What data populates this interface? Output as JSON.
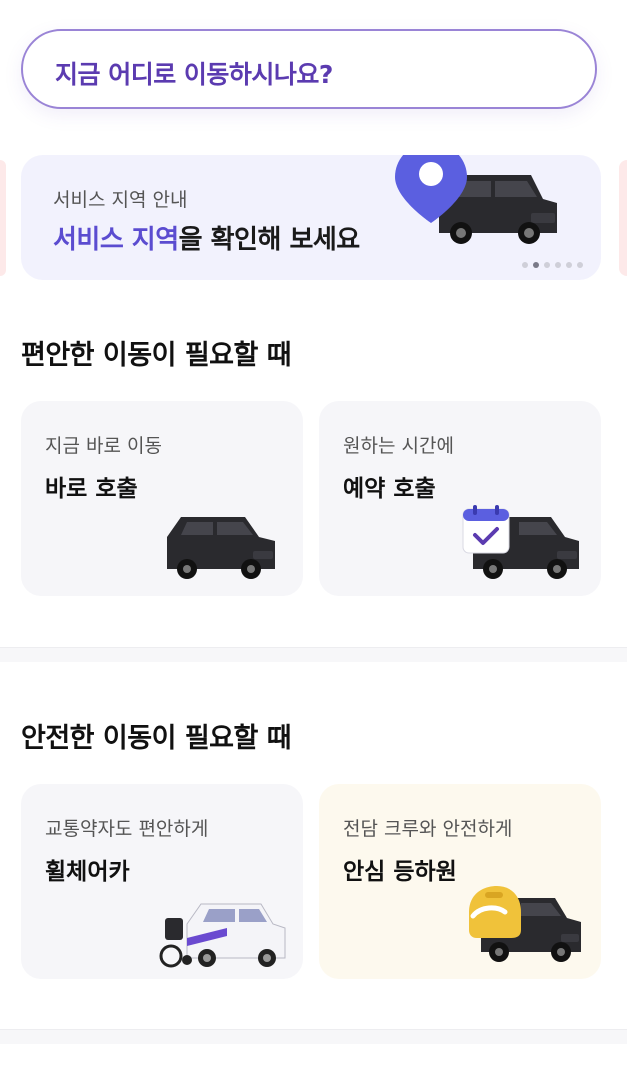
{
  "search": {
    "placeholder": "지금 어디로 이동하시나요?"
  },
  "banner": {
    "subtitle": "서비스 지역 안내",
    "title_highlight": "서비스 지역",
    "title_rest": "을 확인해 보세요",
    "page_index": 2,
    "page_count": 6
  },
  "sections": [
    {
      "title": "편안한 이동이 필요할 때",
      "cards": [
        {
          "subtitle": "지금 바로 이동",
          "title": "바로 호출",
          "icon": "van-icon"
        },
        {
          "subtitle": "원하는 시간에",
          "title": "예약 호출",
          "icon": "calendar-van-icon"
        }
      ]
    },
    {
      "title": "안전한 이동이 필요할 때",
      "cards": [
        {
          "subtitle": "교통약자도 편안하게",
          "title": "휠체어카",
          "icon": "wheelchair-van-icon"
        },
        {
          "subtitle": "전담 크루와 안전하게",
          "title": "안심 등하원",
          "icon": "school-van-icon"
        }
      ]
    }
  ],
  "colors": {
    "accent": "#5b3bb0",
    "highlight": "#5b4cd0",
    "card_bg": "#f6f6f9",
    "warm_card_bg": "#fdf9ee"
  }
}
